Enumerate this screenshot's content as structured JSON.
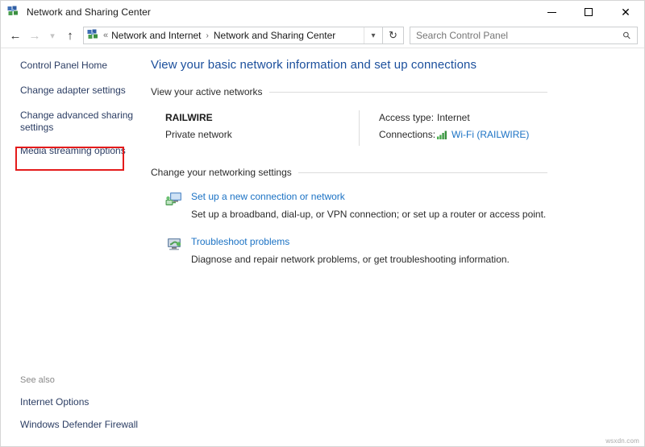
{
  "window": {
    "title": "Network and Sharing Center",
    "icon": "network-sharing-center-icon",
    "controls": {
      "minimize": "minimize-icon",
      "maximize": "maximize-icon",
      "close": "close-icon"
    }
  },
  "toolbar": {
    "back": "back-arrow-icon",
    "forward": "forward-arrow-icon",
    "recent": "chevron-down-icon",
    "up": "up-arrow-icon",
    "address": {
      "icon": "network-sharing-center-icon",
      "overflow": "«",
      "crumbs": [
        "Network and Internet",
        "Network and Sharing Center"
      ],
      "separator": "›",
      "dropdown": "chevron-down-icon"
    },
    "refresh": "refresh-icon",
    "search": {
      "placeholder": "Search Control Panel",
      "value": "",
      "icon": "search-icon"
    }
  },
  "sidebar": {
    "items": [
      {
        "label": "Control Panel Home",
        "highlighted": false
      },
      {
        "label": "Change adapter settings",
        "highlighted": false
      },
      {
        "label": "Change advanced sharing settings",
        "highlighted": true
      },
      {
        "label": "Media streaming options",
        "highlighted": false
      }
    ],
    "see_also": {
      "title": "See also",
      "links": [
        "Internet Options",
        "Windows Defender Firewall"
      ]
    },
    "highlight_color": "#e41b1b"
  },
  "main": {
    "page_title": "View your basic network information and set up connections",
    "active_networks": {
      "section_title": "View your active networks",
      "network": {
        "name": "RAILWIRE",
        "type": "Private network",
        "access_type_label": "Access type:",
        "access_type_value": "Internet",
        "connections_label": "Connections:",
        "connections_value": "Wi-Fi (RAILWIRE)",
        "connections_icon": "wifi-signal-icon"
      }
    },
    "networking_settings": {
      "section_title": "Change your networking settings",
      "tasks": [
        {
          "icon": "new-connection-icon",
          "link": "Set up a new connection or network",
          "description": "Set up a broadband, dial-up, or VPN connection; or set up a router or access point."
        },
        {
          "icon": "troubleshoot-icon",
          "link": "Troubleshoot problems",
          "description": "Diagnose and repair network problems, or get troubleshooting information."
        }
      ]
    }
  },
  "watermark": "wsxdn.com",
  "colors": {
    "link": "#1b72c4",
    "sidebar_link": "#2b3d63",
    "title": "#1b4f9c",
    "highlight": "#e41b1b",
    "wifi_green": "#3ba340"
  }
}
